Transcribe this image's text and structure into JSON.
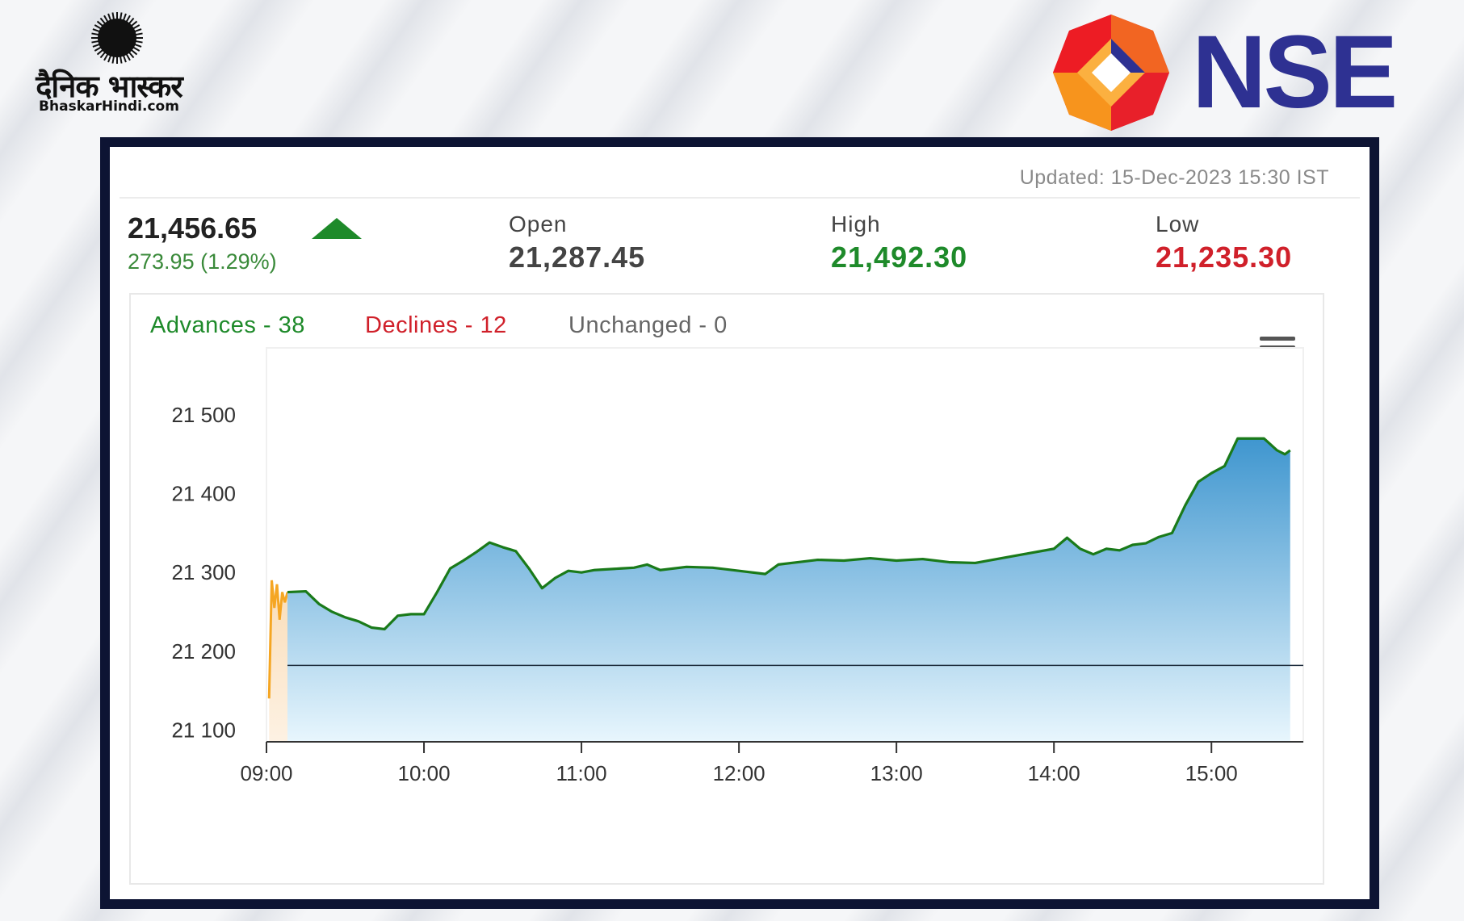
{
  "branding": {
    "left_logo_text": "दैनिक भास्कर",
    "left_logo_site": "BhaskarHindi.com",
    "right_logo_text": "NSE"
  },
  "quote": {
    "updated": "Updated: 15-Dec-2023 15:30 IST",
    "last_price": "21,456.65",
    "change": "273.95 (1.29%)",
    "direction_icon": "up-triangle-icon",
    "open_label": "Open",
    "open_value": "21,287.45",
    "high_label": "High",
    "high_value": "21,492.30",
    "low_label": "Low",
    "low_value": "21,235.30"
  },
  "breadth": {
    "advances": "Advances - 38",
    "declines": "Declines - 12",
    "unchanged": "Unchanged - 0"
  },
  "colors": {
    "advance": "#1e8a2a",
    "decline": "#d0202a",
    "neutral": "#666666",
    "high": "#1e8a2a",
    "low": "#d0202a",
    "line": "#1a7a1a",
    "preopen": "#f5a623",
    "area_top": "#3f96cf",
    "area_bottom": "#e8f6fd",
    "nse_blue": "#2e3192"
  },
  "chart_data": {
    "type": "area",
    "title": "",
    "xlabel": "",
    "ylabel": "",
    "x_ticks": [
      "09:00",
      "10:00",
      "11:00",
      "12:00",
      "13:00",
      "14:00",
      "15:00"
    ],
    "y_ticks": [
      "21 100",
      "21 200",
      "21 300",
      "21 400",
      "21 500"
    ],
    "ylim": [
      21085,
      21585
    ],
    "xlim": [
      "09:00",
      "15:35"
    ],
    "reference_line": 21182,
    "preopen_series": {
      "x": [
        "09:01",
        "09:02",
        "09:03",
        "09:04",
        "09:05",
        "09:06",
        "09:07",
        "09:08"
      ],
      "y": [
        21140,
        21290,
        21255,
        21285,
        21240,
        21275,
        21262,
        21275
      ]
    },
    "series": [
      {
        "x": [
          "09:08",
          "09:15",
          "09:20",
          "09:25",
          "09:30",
          "09:35",
          "09:40",
          "09:45",
          "09:50",
          "09:55",
          "10:00",
          "10:05",
          "10:10",
          "10:15",
          "10:20",
          "10:25",
          "10:30",
          "10:35",
          "10:40",
          "10:45",
          "10:50",
          "10:55",
          "11:00",
          "11:05",
          "11:10",
          "11:15",
          "11:20",
          "11:25",
          "11:30",
          "11:40",
          "11:50",
          "12:00",
          "12:10",
          "12:15",
          "12:20",
          "12:30",
          "12:40",
          "12:50",
          "13:00",
          "13:10",
          "13:20",
          "13:30",
          "13:40",
          "13:50",
          "14:00",
          "14:05",
          "14:10",
          "14:15",
          "14:20",
          "14:25",
          "14:30",
          "14:35",
          "14:40",
          "14:45",
          "14:50",
          "14:55",
          "15:00",
          "15:05",
          "15:10",
          "15:15",
          "15:20",
          "15:25",
          "15:28",
          "15:30"
        ],
        "y": [
          21275,
          21276,
          21260,
          21250,
          21243,
          21238,
          21230,
          21228,
          21245,
          21247,
          21247,
          21275,
          21305,
          21315,
          21326,
          21338,
          21332,
          21327,
          21305,
          21280,
          21293,
          21302,
          21300,
          21303,
          21304,
          21305,
          21306,
          21310,
          21303,
          21307,
          21306,
          21302,
          21298,
          21310,
          21312,
          21316,
          21315,
          21318,
          21315,
          21317,
          21313,
          21312,
          21318,
          21324,
          21330,
          21344,
          21330,
          21323,
          21330,
          21328,
          21335,
          21337,
          21345,
          21350,
          21385,
          21415,
          21426,
          21435,
          21470,
          21470,
          21470,
          21455,
          21450,
          21455
        ]
      }
    ],
    "grid": false,
    "legend": "none"
  }
}
